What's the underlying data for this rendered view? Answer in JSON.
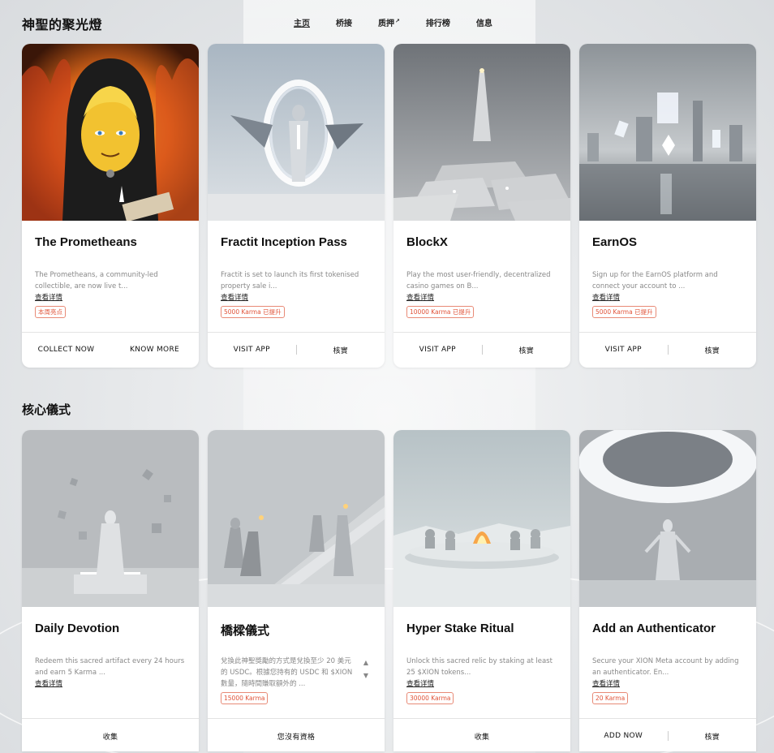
{
  "brand": "神聖的聚光燈",
  "nav": [
    {
      "label": "主页",
      "active": true
    },
    {
      "label": "桥接"
    },
    {
      "label": "质押",
      "external": "↗"
    },
    {
      "label": "排行榜"
    },
    {
      "label": "信息"
    }
  ],
  "section2_title": "核心儀式",
  "more_label": "查看详情",
  "top_cards": [
    {
      "title": "The Prometheans",
      "desc": "The Prometheans, a community-led collectible, are now live t...",
      "badge": "本周亮点",
      "actions": [
        "COLLECT NOW",
        "KNOW MORE"
      ]
    },
    {
      "title": "Fractit Inception Pass",
      "desc": "Fractit is set to launch its first tokenised property sale i...",
      "badge": "5000 Karma 已提升",
      "actions": [
        "VISIT APP",
        "核實"
      ]
    },
    {
      "title": "BlockX",
      "desc": "Play the most user-friendly, decentralized casino games on B...",
      "badge": "10000 Karma 已提升",
      "actions": [
        "VISIT APP",
        "核實"
      ]
    },
    {
      "title": "EarnOS",
      "desc": "Sign up for the EarnOS platform and connect your account to ...",
      "badge": "5000 Karma 已提升",
      "actions": [
        "VISIT APP",
        "核實"
      ]
    }
  ],
  "bottom_cards": [
    {
      "title": "Daily Devotion",
      "desc": "Redeem this sacred artifact every 24 hours and earn 5 Karma ...",
      "actions": [
        "收集"
      ]
    },
    {
      "title": "橋樑儀式",
      "desc": "兌換此神聖獎勵的方式是兌換至少 20 美元的 USDC。根據您持有的 USDC 和 $XION 數量，隨時間賺取額外的 ...",
      "badge": "15000 Karma",
      "actions": [
        "您沒有資格"
      ]
    },
    {
      "title": "Hyper Stake Ritual",
      "desc": "Unlock this sacred relic by staking at least 25 $XION tokens...",
      "badge": "30000 Karma",
      "actions": [
        "收集"
      ]
    },
    {
      "title": "Add an Authenticator",
      "desc": "Secure your XION Meta account by adding an authenticator. En...",
      "badge": "20 Karma",
      "actions": [
        "ADD NOW",
        "核實"
      ]
    }
  ],
  "icons": {
    "scroll_up": "▲",
    "scroll_down": "▼"
  },
  "colors": {
    "badge": "#e0543a",
    "background": "#e7e9eb"
  }
}
